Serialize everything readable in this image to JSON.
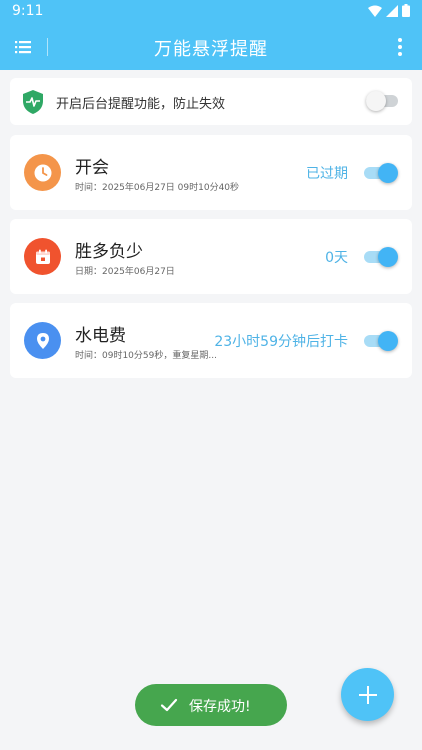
{
  "status_bar": {
    "time": "9:11"
  },
  "app": {
    "title": "万能悬浮提醒",
    "accent_color": "#4fc3f7",
    "menu_icon": "list-menu-icon",
    "more_icon": "more-vertical-icon"
  },
  "notice": {
    "icon": "shield-pulse-icon",
    "text": "开启后台提醒功能，防止失效",
    "enabled": false
  },
  "reminders": [
    {
      "title": "开会",
      "subtitle": "时间：2025年06月27日   09时10分40秒",
      "status": "已过期",
      "icon": "clock-icon",
      "icon_color": "#f4954a",
      "enabled": true
    },
    {
      "title": "胜多负少",
      "subtitle": "日期：2025年06月27日",
      "status": "0天",
      "icon": "calendar-icon",
      "icon_color": "#f0532e",
      "enabled": true
    },
    {
      "title": "水电费",
      "subtitle": "时间：09时10分59秒，重复星期...",
      "status": "23小时59分钟后打卡",
      "icon": "location-pin-icon",
      "icon_color": "#4a90f0",
      "enabled": true
    }
  ],
  "toast": {
    "text": "保存成功!",
    "icon": "check-icon",
    "color": "#46a64e"
  },
  "fab": {
    "icon": "plus-icon"
  }
}
